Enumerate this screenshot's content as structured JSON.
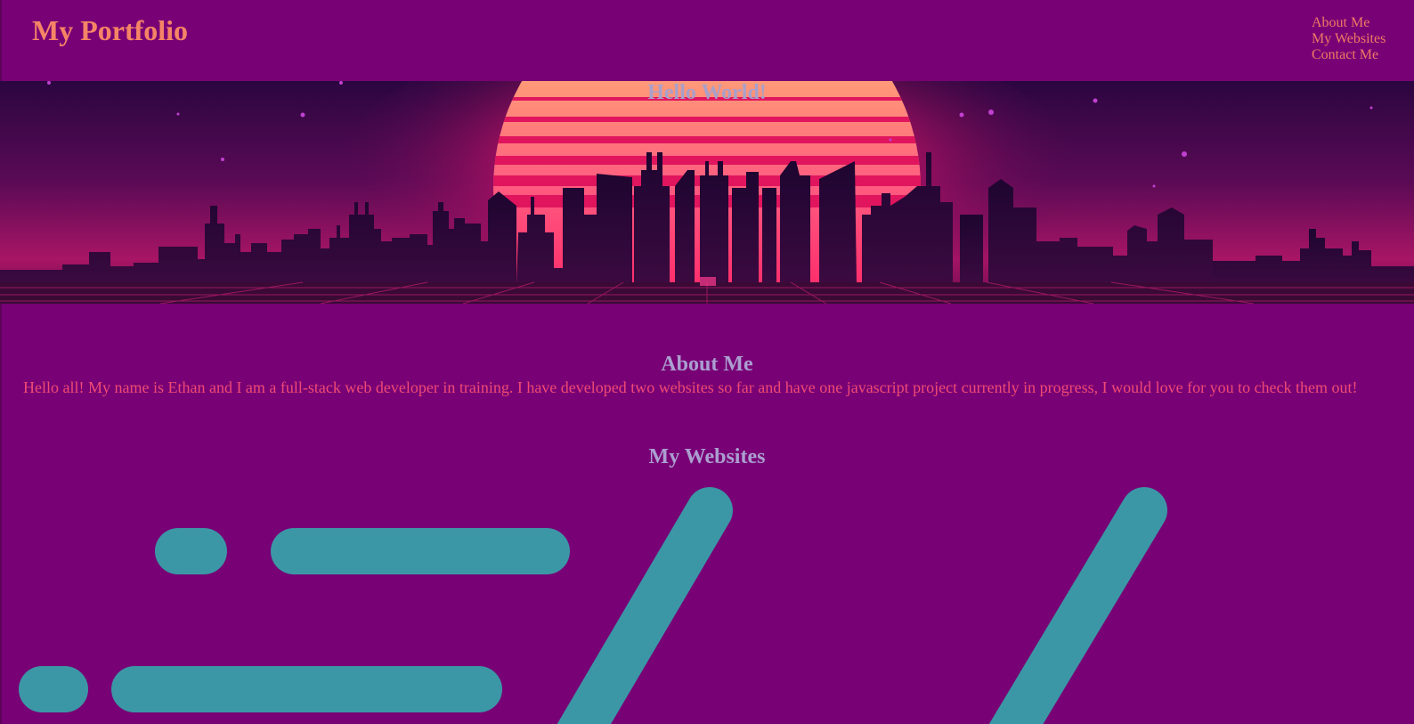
{
  "header": {
    "brand": "My Portfolio",
    "nav": [
      {
        "label": "About Me"
      },
      {
        "label": "My Websites"
      },
      {
        "label": "Contact Me"
      }
    ]
  },
  "hero": {
    "title": "Hello World!"
  },
  "about": {
    "heading": "About Me",
    "text": "Hello all! My name is Ethan and I am a full-stack web developer in training. I have developed two websites so far and have one javascript project currently in progress, I would love for you to check them out!"
  },
  "websites": {
    "heading": "My Websites"
  },
  "colors": {
    "background": "#780275",
    "brand": "#f58466",
    "heading": "#ab9fd1",
    "body_text": "#f04a74",
    "accent": "#3b97a6"
  }
}
